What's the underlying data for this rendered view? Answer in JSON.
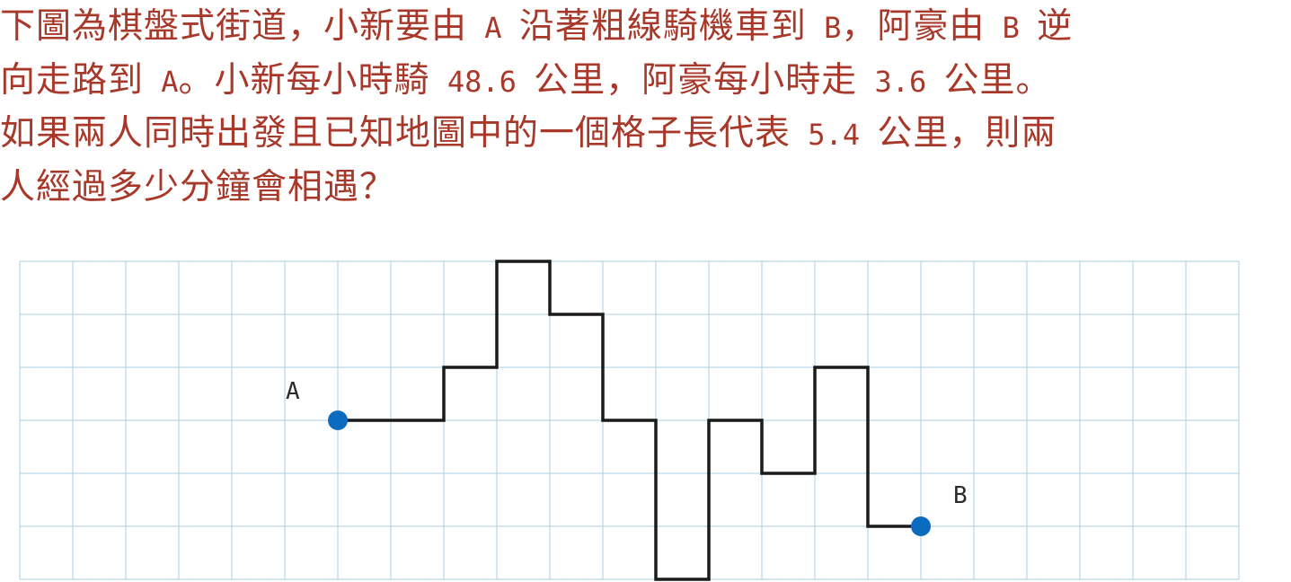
{
  "question": {
    "line1": "下圖為棋盤式街道，小新要由 A 沿著粗線騎機車到 B，阿豪由 B 逆",
    "line2": "向走路到 A。小新每小時騎 48.6 公里，阿豪每小時走 3.6 公里。",
    "line3": "如果兩人同時出發且已知地圖中的一個格子長代表 5.4 公里，則兩",
    "line4": "人經過多少分鐘會相遇？"
  },
  "diagram": {
    "label_a": "A",
    "label_b": "B",
    "grid": {
      "columns": 23,
      "rows": 6
    },
    "start": [
      6,
      3
    ],
    "end": [
      17,
      5
    ],
    "route": [
      [
        6,
        3
      ],
      [
        8,
        3
      ],
      [
        8,
        2
      ],
      [
        9,
        2
      ],
      [
        9,
        0
      ],
      [
        10,
        0
      ],
      [
        10,
        1
      ],
      [
        11,
        1
      ],
      [
        11,
        3
      ],
      [
        12,
        3
      ],
      [
        12,
        6
      ],
      [
        13,
        6
      ],
      [
        13,
        3
      ],
      [
        14,
        3
      ],
      [
        14,
        4
      ],
      [
        15,
        4
      ],
      [
        15,
        2
      ],
      [
        16,
        2
      ],
      [
        16,
        5
      ],
      [
        17,
        5
      ]
    ],
    "colors": {
      "grid": "#a9cfe0",
      "route": "#1a1a1a",
      "point": "#0b6cbf",
      "question_text": "#a8392a"
    }
  }
}
